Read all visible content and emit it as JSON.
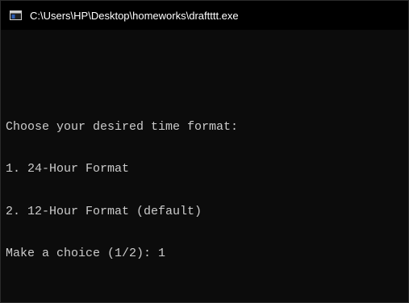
{
  "window": {
    "title": "C:\\Users\\HP\\Desktop\\homeworks\\draftttt.exe",
    "icon": "console-app-icon"
  },
  "console": {
    "lines": [
      "",
      "Choose your desired time format:",
      "1. 24-Hour Format",
      "2. 12-Hour Format (default)",
      "Make a choice (1/2): 1"
    ]
  },
  "colors": {
    "background": "#0c0c0c",
    "titlebar": "#000000",
    "text": "#cccccc",
    "title_text": "#ffffff"
  }
}
